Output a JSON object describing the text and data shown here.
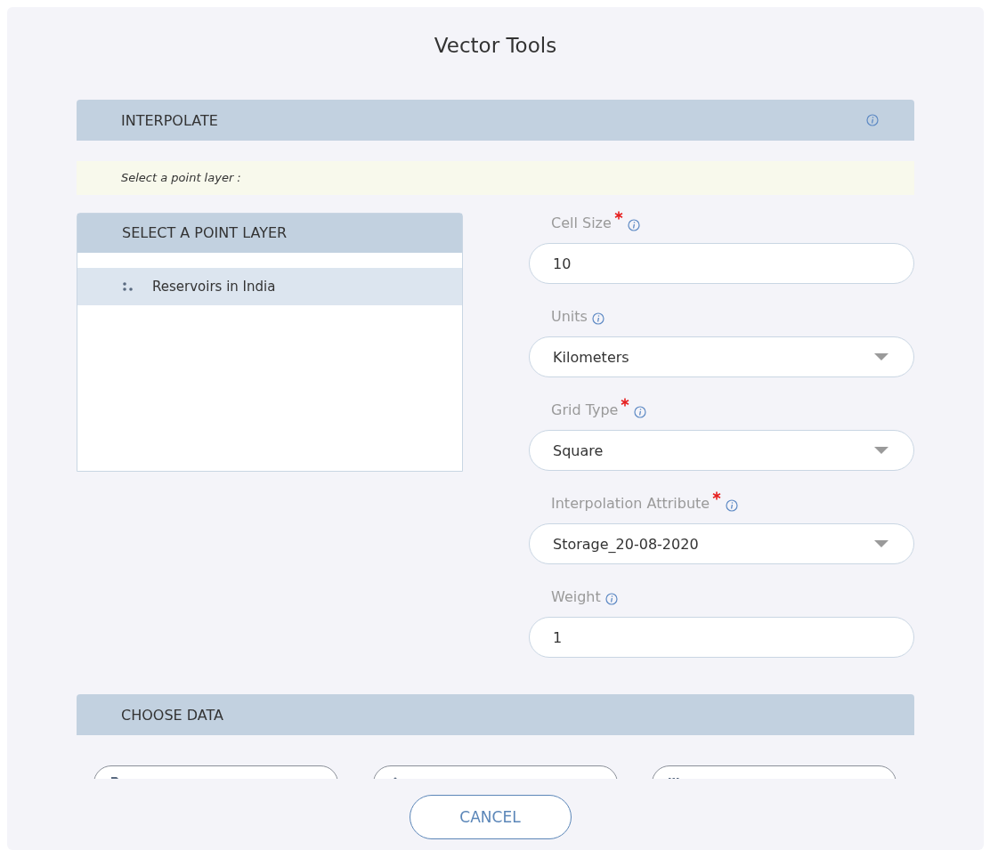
{
  "window": {
    "title": "Vector Tools"
  },
  "interpolate": {
    "title": "INTERPOLATE",
    "hint": "Select a point layer :"
  },
  "point_layers": {
    "title": "SELECT A POINT LAYER",
    "items": [
      {
        "label": "Reservoirs in India",
        "selected": true
      }
    ]
  },
  "fields": [
    {
      "kind": "input",
      "label": "Cell Size",
      "required": true,
      "value": "10"
    },
    {
      "kind": "select",
      "label": "Units",
      "required": false,
      "value": "Kilometers"
    },
    {
      "kind": "select",
      "label": "Grid Type",
      "required": true,
      "value": "Square"
    },
    {
      "kind": "select",
      "label": "Interpolation Attribute",
      "required": true,
      "value": "Storage_20-08-2020"
    },
    {
      "kind": "input",
      "label": "Weight",
      "required": false,
      "value": "1"
    }
  ],
  "choose_data": {
    "title": "CHOOSE DATA",
    "options": [
      {
        "kind": "query"
      },
      {
        "kind": "graphics"
      },
      {
        "kind": "all"
      }
    ]
  },
  "buttons": [
    "CANCEL"
  ]
}
